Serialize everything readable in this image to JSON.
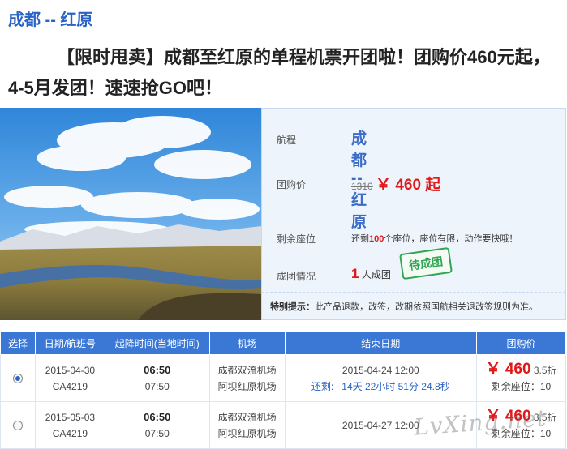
{
  "header": {
    "route_title": "成都 -- 红原",
    "headline": "【限时甩卖】成都至红原的单程机票开团啦！团购价460元起，4-5月发团！速速抢GO吧！"
  },
  "info": {
    "route_label": "航程",
    "route_value": "成都 -- 红原",
    "price_label": "团购价",
    "old_price": "1310",
    "new_price": "￥ 460 起",
    "seats_label": "剩余座位",
    "seats_prefix": "还剩",
    "seats_count": "100",
    "seats_suffix": "个座位，座位有限，动作要快哦！",
    "group_label": "成团情况",
    "group_count": "1",
    "group_suffix": "人成团",
    "stamp": "待成团",
    "note_label": "特别提示：",
    "note_text": "此产品退款，改签，改期依照国航相关退改签规则为准。"
  },
  "table": {
    "headers": [
      "选择",
      "日期/航班号",
      "起降时间(当地时间)",
      "机场",
      "结束日期",
      "团购价"
    ],
    "rows": [
      {
        "selected": true,
        "date": "2015-04-30",
        "flight": "CA4219",
        "depart": "06:50",
        "arrive": "07:50",
        "airport_from": "成都双流机场",
        "airport_to": "阿坝红原机场",
        "end_date": "2015-04-24 12:00",
        "countdown_label": "还剩:",
        "countdown": "14天 22小时 51分 24.8秒",
        "price": "￥ 460",
        "discount": "3.5折",
        "remain": "剩余座位：10"
      },
      {
        "selected": false,
        "date": "2015-05-03",
        "flight": "CA4219",
        "depart": "06:50",
        "arrive": "07:50",
        "airport_from": "成都双流机场",
        "airport_to": "阿坝红原机场",
        "end_date": "2015-04-27 12:00",
        "countdown_label": "",
        "countdown": "",
        "price": "￥ 460",
        "discount": "3.5折",
        "remain": "剩余座位：10"
      }
    ]
  },
  "watermark": "LvXing.net",
  "colors": {
    "accent": "#2a63c6",
    "header_bg": "#3b78d6",
    "price": "#e01818",
    "stamp": "#2fa552"
  }
}
